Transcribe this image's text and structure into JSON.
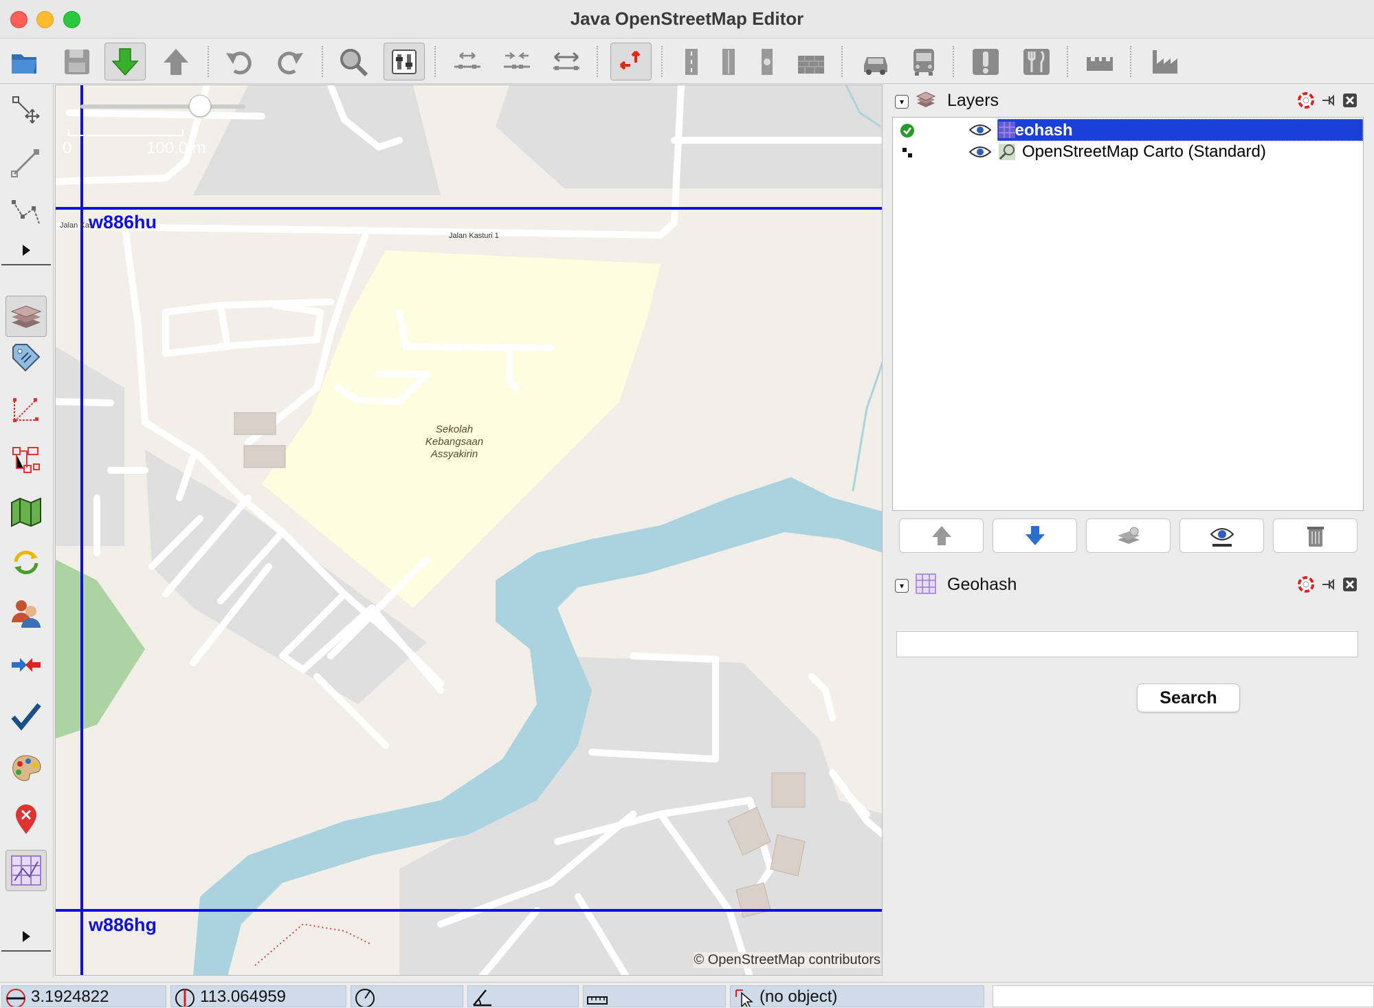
{
  "window": {
    "title": "Java OpenStreetMap Editor"
  },
  "map": {
    "scale_zero": "0",
    "scale_label": "100.0 m",
    "geohash_top": "w886hu",
    "geohash_bottom": "w886hg",
    "road_label_1": "Jalan Kasturi 1",
    "road_label_2": "Jalan Kas",
    "school_label_line1": "Sekolah",
    "school_label_line2": "Kebangsaan",
    "school_label_line3": "Assyakirin",
    "attribution": "© OpenStreetMap contributors"
  },
  "layers_panel": {
    "title": "Layers",
    "layers": [
      {
        "name": "Geohash",
        "selected": true,
        "visible": true,
        "active": true
      },
      {
        "name": "OpenStreetMap Carto (Standard)",
        "selected": false,
        "visible": true,
        "active": false
      }
    ]
  },
  "geohash_panel": {
    "title": "Geohash",
    "search_value": "",
    "search_button": "Search"
  },
  "statusbar": {
    "latitude": "3.1924822",
    "longitude": "113.064959",
    "heading": "",
    "angle": "",
    "distance": "",
    "selection": "(no object)"
  },
  "colors": {
    "geohash_line": "#1010e0",
    "selected_row": "#1a3ed8",
    "water": "#aad3df",
    "school": "#fffde0",
    "building": "#d9d0c9",
    "landuse": "#e0dfdf"
  }
}
